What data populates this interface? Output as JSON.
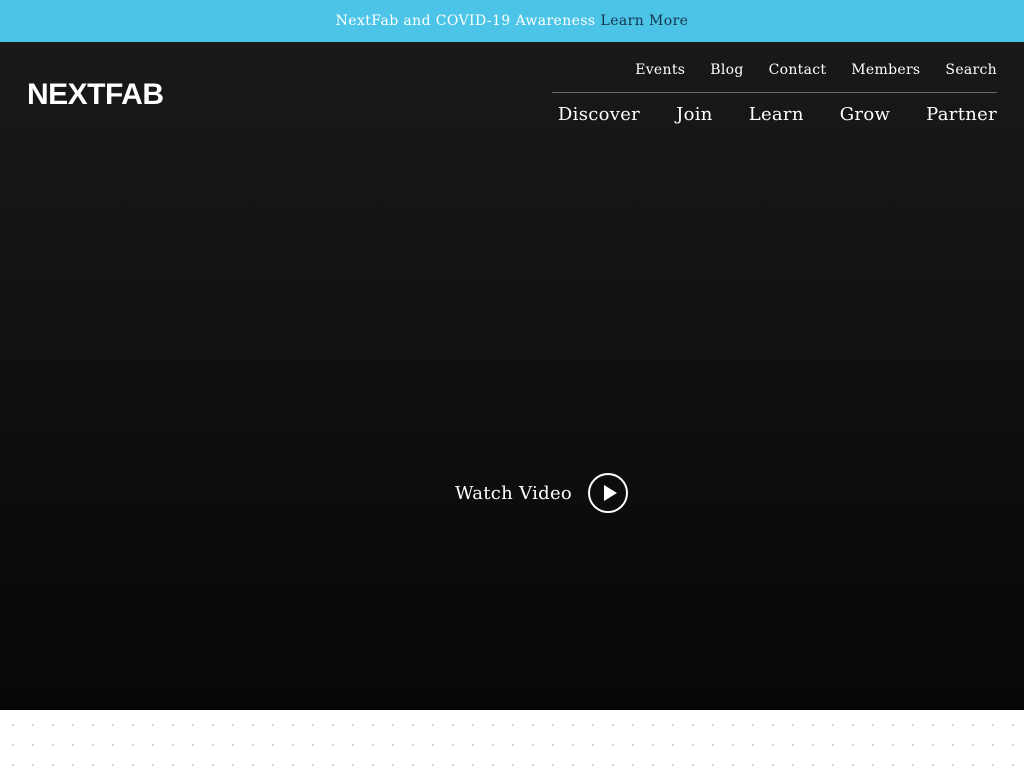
{
  "banner": {
    "message": "NextFab and COVID-19 Awareness",
    "link_label": "Learn More",
    "background_color": "#4bc4e8"
  },
  "header": {
    "logo_text": "NEXTFAB",
    "utility_nav": [
      {
        "label": "Events"
      },
      {
        "label": "Blog"
      },
      {
        "label": "Contact"
      },
      {
        "label": "Members"
      },
      {
        "label": "Search"
      }
    ],
    "main_nav": [
      {
        "label": "Discover"
      },
      {
        "label": "Join"
      },
      {
        "label": "Learn"
      },
      {
        "label": "Grow"
      },
      {
        "label": "Partner"
      }
    ]
  },
  "hero": {
    "watch_video_label": "Watch Video",
    "play_icon": "play-icon"
  }
}
